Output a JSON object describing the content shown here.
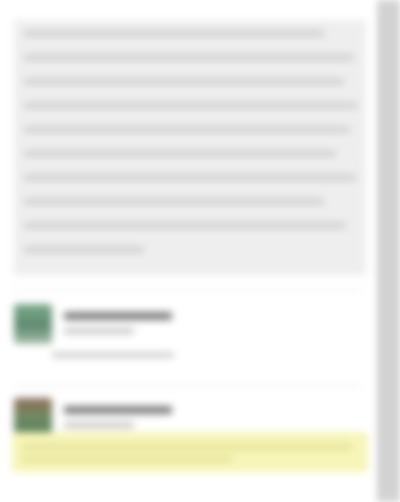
{
  "article": {
    "redacted": true
  },
  "comments": [
    {
      "author": "",
      "meta": "",
      "highlighted": false
    },
    {
      "author": "",
      "meta": "",
      "highlighted": true
    }
  ],
  "colors": {
    "highlight": "#f7f5b8",
    "scrollbar": "#cfcfcf",
    "background": "#ffffff"
  }
}
